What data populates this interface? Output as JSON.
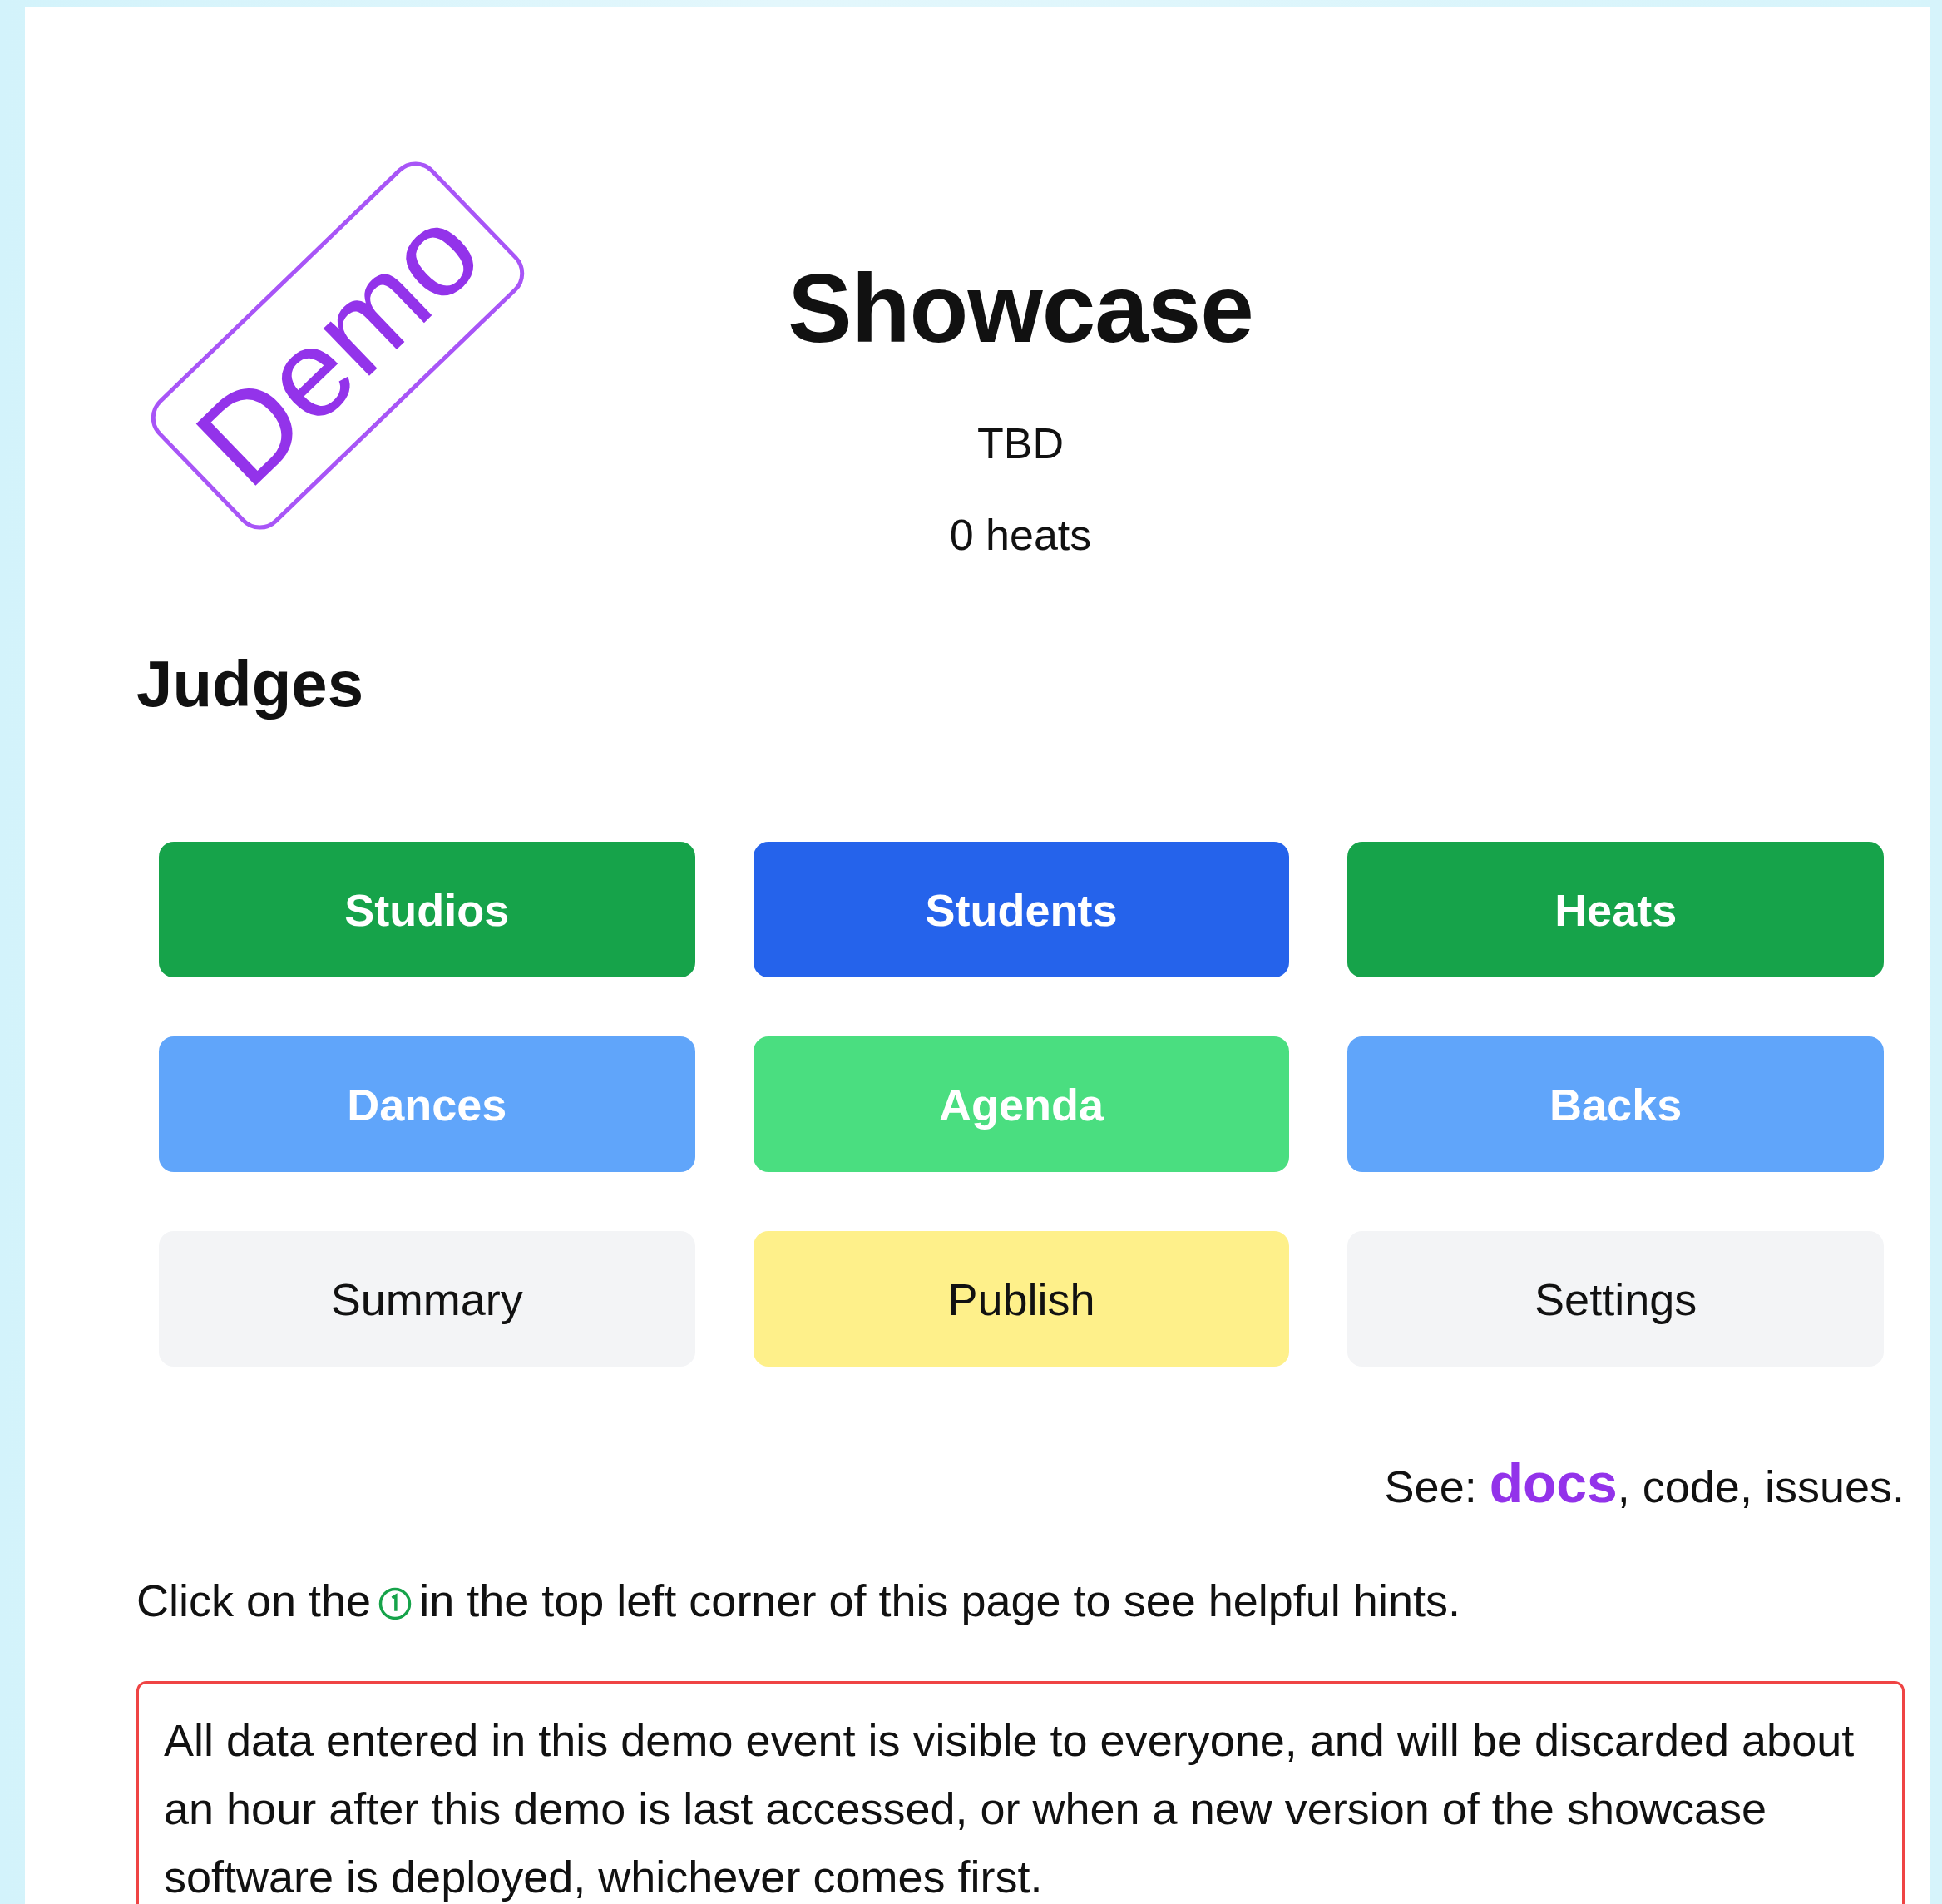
{
  "stamp": {
    "text": "Demo"
  },
  "title": "Showcase",
  "date": "TBD",
  "heat_count": "0 heats",
  "section_heading": "Judges",
  "buttons": [
    {
      "label": "Studios",
      "color": "#16a34a",
      "text_dark": false
    },
    {
      "label": "Students",
      "color": "#2563eb",
      "text_dark": false
    },
    {
      "label": "Heats",
      "color": "#16a34a",
      "text_dark": false
    },
    {
      "label": "Dances",
      "color": "#60a5fa",
      "text_dark": false
    },
    {
      "label": "Agenda",
      "color": "#4ade80",
      "text_dark": false
    },
    {
      "label": "Backs",
      "color": "#60a5fa",
      "text_dark": false
    },
    {
      "label": "Summary",
      "color": "#f3f4f6",
      "text_dark": true
    },
    {
      "label": "Publish",
      "color": "#fef08a",
      "text_dark": true
    },
    {
      "label": "Settings",
      "color": "#f3f4f6",
      "text_dark": true
    }
  ],
  "see_also": {
    "prefix": "See:",
    "links": [
      {
        "label": "docs",
        "suffix": ",",
        "emphasized": true
      },
      {
        "label": "code",
        "suffix": ",",
        "emphasized": false
      },
      {
        "label": "issues",
        "suffix": ".",
        "emphasized": false
      }
    ]
  },
  "hint": {
    "before": "Click on the",
    "after": "in the top left corner of this page to see helpful hints."
  },
  "notice": "All data entered in this demo event is visible to everyone, and will be discarded about an hour after this demo is last accessed, or when a new version of the showcase software is deployed, whichever comes first."
}
